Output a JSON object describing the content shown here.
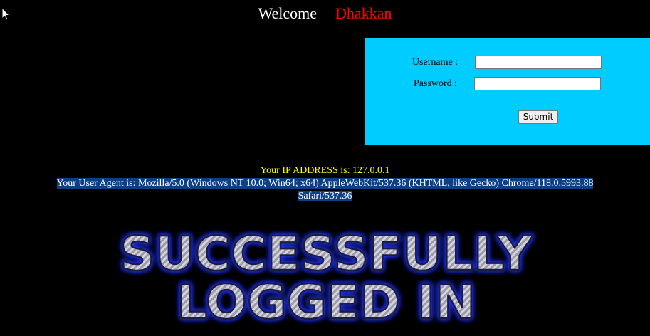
{
  "header": {
    "welcome_label": "Welcome",
    "user_name": "Dhakkan"
  },
  "login": {
    "username_label": "Username :",
    "password_label": "Password :",
    "username_value": "",
    "password_value": "",
    "submit_label": "Submit"
  },
  "info": {
    "ip_text": "Your IP ADDRESS is: 127.0.0.1",
    "user_agent_line1": "Your User Agent is: Mozilla/5.0 (Windows NT 10.0; Win64; x64) AppleWebKit/537.36 (KHTML, like Gecko) Chrome/118.0.5993.88",
    "user_agent_line2": "Safari/537.36"
  },
  "banner": {
    "line1": "SUCCESSFULLY",
    "line2": "LOGGED IN"
  },
  "colors": {
    "background": "#000000",
    "panel": "#00ccff",
    "name": "#ff0000",
    "ip": "#ffff00",
    "ua_highlight": "#0e3f86",
    "banner_glow": "#2233ff"
  },
  "icons": {
    "cursor": "mouse-pointer-icon"
  }
}
